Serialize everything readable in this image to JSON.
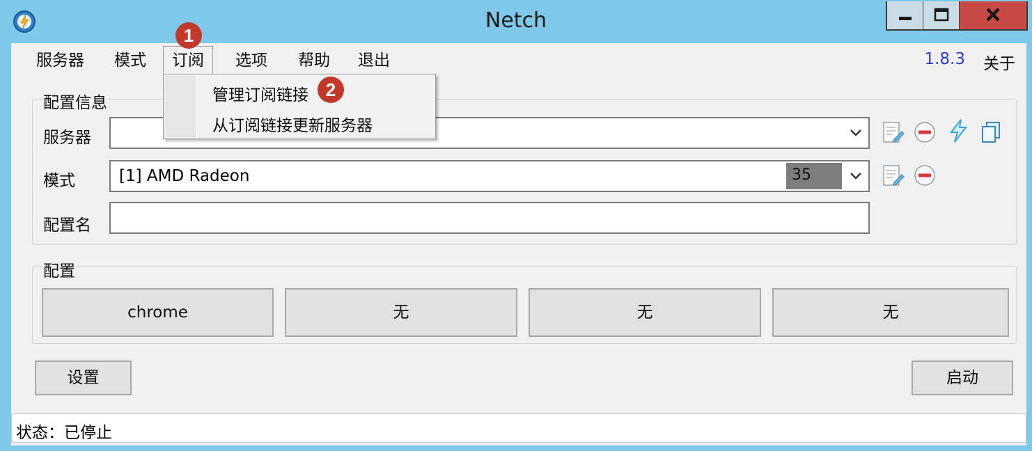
{
  "window": {
    "title": "Netch"
  },
  "menu": {
    "items": [
      "服务器",
      "模式",
      "订阅",
      "选项",
      "帮助",
      "退出"
    ],
    "version": "1.8.3",
    "about": "关于"
  },
  "subscription_menu": {
    "items": [
      "管理订阅链接",
      "从订阅链接更新服务器"
    ]
  },
  "annotations": [
    "1",
    "2"
  ],
  "config_info": {
    "group_title": "配置信息",
    "server_label": "服务器",
    "server_value": "",
    "mode_label": "模式",
    "mode_value": "[1] AMD Radeon",
    "mode_latency": "35",
    "profile_name_label": "配置名",
    "profile_name_value": ""
  },
  "profiles": {
    "group_title": "配置",
    "buttons": [
      "chrome",
      "无",
      "无",
      "无"
    ]
  },
  "buttons": {
    "settings": "设置",
    "start": "启动"
  },
  "status": {
    "text": "状态：已停止"
  },
  "colors": {
    "titlebar": "#7ec8ea",
    "badge": "#c0392b",
    "version": "#2b3bd6",
    "close": "#c74a44"
  }
}
